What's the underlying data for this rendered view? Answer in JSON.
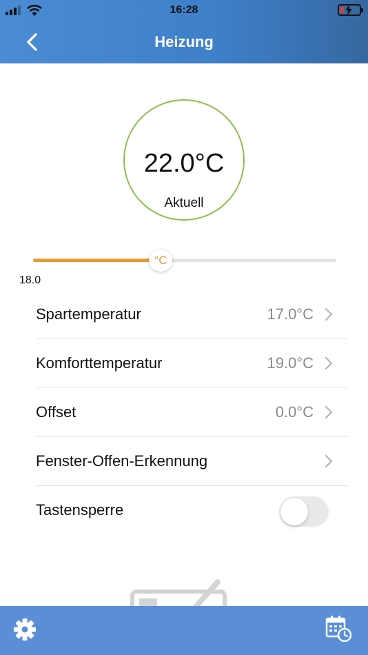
{
  "status_bar": {
    "time": "16:28"
  },
  "header": {
    "title": "Heizung"
  },
  "gauge": {
    "value": "22.0°C",
    "label": "Aktuell"
  },
  "slider": {
    "thumb_unit": "°C",
    "min_label": "18.0",
    "fill_fraction": 0.42
  },
  "settings": [
    {
      "label": "Spartemperatur",
      "value": "17.0°C"
    },
    {
      "label": "Komforttemperatur",
      "value": "19.0°C"
    },
    {
      "label": "Offset",
      "value": "0.0°C"
    },
    {
      "label": "Fenster-Offen-Erkennung",
      "value": ""
    },
    {
      "label": "Tastensperre",
      "toggle": false
    }
  ],
  "icons": {
    "back": "chevron-left-icon",
    "settings": "gear-icon",
    "schedule": "calendar-clock-icon"
  },
  "colors": {
    "header": "#3e7fc9",
    "tabbar": "#5a8fd8",
    "gauge_ring": "#8fc04a",
    "slider_fill": "#e69a36",
    "value_text": "#8a8a8a"
  }
}
